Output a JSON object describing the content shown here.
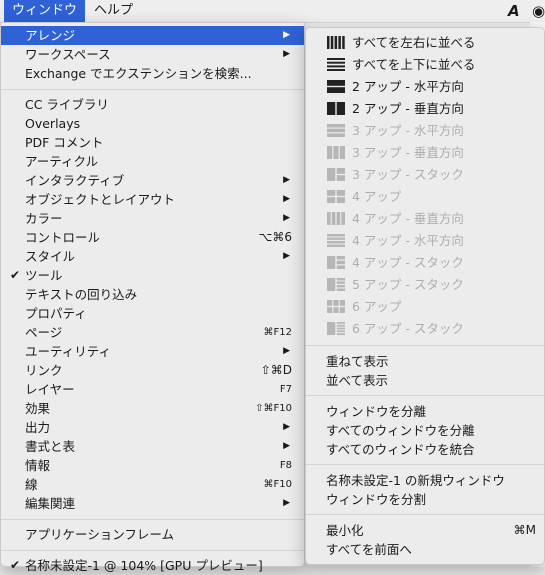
{
  "menubar": {
    "window_menu": "ウィンドウ",
    "help_menu": "ヘルプ",
    "tray_icon_1": "A-icon",
    "tray_icon_2": "target-icon"
  },
  "colors": {
    "highlight": "#2f62d7",
    "enabled_icon": "#222222",
    "disabled_icon": "#b6b6b6"
  },
  "main_menu": [
    {
      "label": "アレンジ",
      "submenu": true,
      "highlighted": true
    },
    {
      "label": "ワークスペース",
      "submenu": true
    },
    {
      "label": "Exchange でエクステンションを検索..."
    },
    {
      "label": "CC ライブラリ"
    },
    {
      "label": "Overlays"
    },
    {
      "label": "PDF コメント"
    },
    {
      "label": "アーティクル"
    },
    {
      "label": "インタラクティブ",
      "submenu": true
    },
    {
      "label": "オブジェクトとレイアウト",
      "submenu": true
    },
    {
      "label": "カラー",
      "submenu": true
    },
    {
      "label": "コントロール",
      "shortcut": "⌥⌘6"
    },
    {
      "label": "スタイル",
      "submenu": true
    },
    {
      "label": "ツール",
      "checked": true
    },
    {
      "label": "テキストの回り込み"
    },
    {
      "label": "プロパティ"
    },
    {
      "label": "ページ",
      "shortcut": "⌘F12"
    },
    {
      "label": "ユーティリティ",
      "submenu": true
    },
    {
      "label": "リンク",
      "shortcut": "⇧⌘D"
    },
    {
      "label": "レイヤー",
      "shortcut": "F7"
    },
    {
      "label": "効果",
      "shortcut": "⇧⌘F10"
    },
    {
      "label": "出力",
      "submenu": true
    },
    {
      "label": "書式と表",
      "submenu": true
    },
    {
      "label": "情報",
      "shortcut": "F8"
    },
    {
      "label": "線",
      "shortcut": "⌘F10"
    },
    {
      "label": "編集関連",
      "submenu": true
    },
    {
      "label": "アプリケーションフレーム"
    },
    {
      "label": "名称未設定-1 @ 104% [GPU プレビュー]",
      "checked": true
    }
  ],
  "arrange_submenu": [
    {
      "label": "すべてを左右に並べる",
      "icon": "tile-vertical-icon",
      "enabled": true
    },
    {
      "label": "すべてを上下に並べる",
      "icon": "tile-horizontal-icon",
      "enabled": true
    },
    {
      "label": "2 アップ - 水平方向",
      "icon": "two-up-horizontal-icon",
      "enabled": true
    },
    {
      "label": "2 アップ - 垂直方向",
      "icon": "two-up-vertical-icon",
      "enabled": true
    },
    {
      "label": "3 アップ - 水平方向",
      "icon": "three-up-horizontal-icon",
      "enabled": false
    },
    {
      "label": "3 アップ - 垂直方向",
      "icon": "three-up-vertical-icon",
      "enabled": false
    },
    {
      "label": "3 アップ - スタック",
      "icon": "three-up-stack-icon",
      "enabled": false
    },
    {
      "label": "4 アップ",
      "icon": "four-up-icon",
      "enabled": false
    },
    {
      "label": "4 アップ - 垂直方向",
      "icon": "four-up-vertical-icon",
      "enabled": false
    },
    {
      "label": "4 アップ - 水平方向",
      "icon": "four-up-horizontal-icon",
      "enabled": false
    },
    {
      "label": "4 アップ - スタック",
      "icon": "four-up-stack-icon",
      "enabled": false
    },
    {
      "label": "5 アップ - スタック",
      "icon": "five-up-stack-icon",
      "enabled": false
    },
    {
      "label": "6 アップ",
      "icon": "six-up-icon",
      "enabled": false
    },
    {
      "label": "6 アップ - スタック",
      "icon": "six-up-stack-icon",
      "enabled": false
    },
    {
      "label": "重ねて表示"
    },
    {
      "label": "並べて表示"
    },
    {
      "label": "ウィンドウを分離"
    },
    {
      "label": "すべてのウィンドウを分離"
    },
    {
      "label": "すべてのウィンドウを統合"
    },
    {
      "label": "名称未設定-1 の新規ウィンドウ"
    },
    {
      "label": "ウィンドウを分割"
    },
    {
      "label": "最小化",
      "shortcut": "⌘M"
    },
    {
      "label": "すべてを前面へ"
    }
  ]
}
